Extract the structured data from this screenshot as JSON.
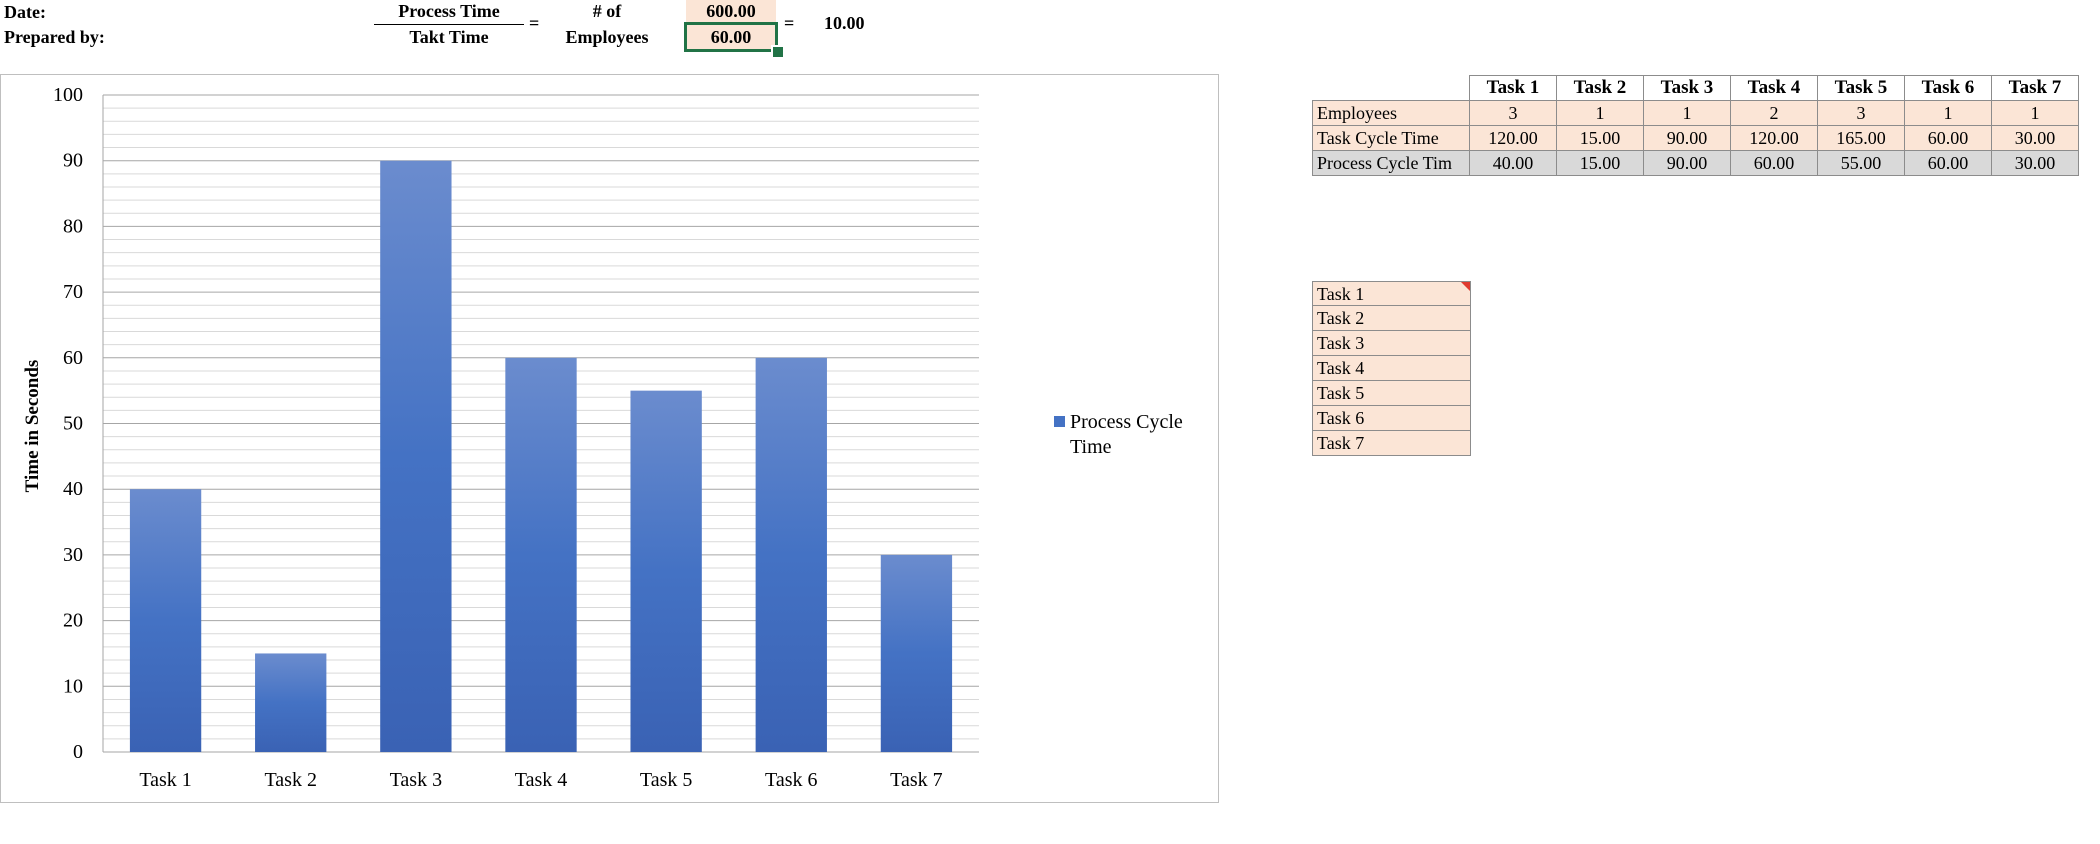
{
  "header": {
    "date_label": "Date:",
    "prepared_label": "Prepared by:",
    "process_time_label": "Process Time",
    "takt_time_label": "Takt Time",
    "equals": "=",
    "num_of_label": "# of",
    "employees_label": "Employees",
    "process_time_value": "600.00",
    "takt_time_value": "60.00",
    "result_value": "10.00"
  },
  "table": {
    "columns": [
      "Task 1",
      "Task 2",
      "Task 3",
      "Task 4",
      "Task 5",
      "Task 6",
      "Task 7"
    ],
    "rows": [
      {
        "label": "Employees",
        "values": [
          "3",
          "1",
          "1",
          "2",
          "3",
          "1",
          "1"
        ]
      },
      {
        "label": "Task Cycle Time",
        "values": [
          "120.00",
          "15.00",
          "90.00",
          "120.00",
          "165.00",
          "60.00",
          "30.00"
        ]
      },
      {
        "label": "Process Cycle Tim",
        "values": [
          "40.00",
          "15.00",
          "90.00",
          "60.00",
          "55.00",
          "60.00",
          "30.00"
        ]
      }
    ]
  },
  "task_list": [
    "Task 1",
    "Task 2",
    "Task 3",
    "Task 4",
    "Task 5",
    "Task 6",
    "Task 7"
  ],
  "colors": {
    "bar": "#4472c4",
    "input_fill": "#fbe5d6",
    "selection": "#217346",
    "computed_fill": "#d9d9d9"
  },
  "chart_data": {
    "type": "bar",
    "categories": [
      "Task 1",
      "Task 2",
      "Task 3",
      "Task 4",
      "Task 5",
      "Task 6",
      "Task 7"
    ],
    "series": [
      {
        "name": "Process Cycle Time",
        "values": [
          40,
          15,
          90,
          60,
          55,
          60,
          30
        ]
      }
    ],
    "ylabel": "Time in Seconds",
    "ylim": [
      0,
      100
    ],
    "yticks": [
      "0",
      "10",
      "20",
      "30",
      "40",
      "50",
      "60",
      "70",
      "80",
      "90",
      "100"
    ],
    "grid": true,
    "legend": "right"
  }
}
